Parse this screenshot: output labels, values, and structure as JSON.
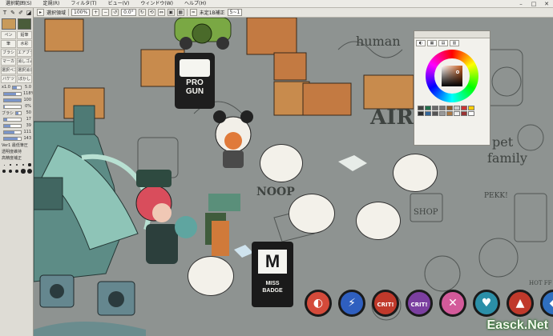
{
  "menubar": {
    "items": [
      "選択範囲(S)",
      "定規(R)",
      "フィルタ(T)",
      "ビュー(V)",
      "ウィンドウ(W)",
      "ヘルプ(H)"
    ],
    "window_buttons": [
      "–",
      "□",
      "✕"
    ]
  },
  "toolbar": {
    "selection_label": "選択領域",
    "zoom": "100%",
    "angle": "0.0°",
    "file_name": "未定1B補正",
    "file_field": "5~1"
  },
  "leftpanel": {
    "tools": [
      "T",
      "✎",
      "✐",
      "◪"
    ],
    "fg_color": "#c89a5a",
    "bg_color": "#4a5c3a",
    "brushes": [
      "ペン",
      "鉛筆",
      "筆",
      "水彩",
      "ブラシ",
      "エアブラ",
      "マーカ",
      "消しゴム",
      "選択ペン",
      "選択消し",
      "バケツ",
      "ぼかし"
    ],
    "sliders": [
      {
        "label": "x1.0",
        "value": "5.0",
        "fill": 0.5
      },
      {
        "label": "",
        "value": "118%",
        "fill": 0.7
      },
      {
        "label": "",
        "value": "100",
        "fill": 1.0
      },
      {
        "label": "",
        "value": "0%",
        "fill": 0.05
      },
      {
        "label": "ブラシ",
        "value": "50",
        "fill": 0.5
      },
      {
        "label": "",
        "value": "17",
        "fill": 0.2
      },
      {
        "label": "",
        "value": "39",
        "fill": 0.4
      },
      {
        "label": "",
        "value": "111",
        "fill": 0.6
      },
      {
        "label": "",
        "value": "143",
        "fill": 0.8
      }
    ],
    "options": [
      "Ver1 最低筆圧",
      "透明度維持",
      "高精度補正"
    ],
    "dot_sizes": [
      "1.5",
      "2",
      "3",
      "4",
      "5",
      "6",
      "7",
      "8",
      "9",
      "10"
    ]
  },
  "canvas": {
    "sketch_texts": [
      "human",
      "AIR",
      "pet",
      "family",
      "PEKK!",
      "SHOP",
      "NOOP",
      "HOT FF"
    ],
    "progun_text": "PRO GUN",
    "miss_badge_text": "MISS BADGE",
    "miss_badge_letter": "M",
    "crit_labels": [
      "CRIT!",
      "CRIT!"
    ]
  },
  "colorpanel": {
    "title": "",
    "tabs": [
      "◐",
      "▦",
      "▤",
      "▥"
    ],
    "swatches": [
      "#444444",
      "#1f6f4a",
      "#6a6a6a",
      "#777777",
      "#8b5a2b",
      "#cccccc",
      "#cc3333",
      "#ffcc00",
      "#2d2d2d",
      "#336699",
      "#555555",
      "#999999",
      "#aa7744",
      "#eeeeee",
      "#993333",
      "#ffffff"
    ]
  },
  "watermark": "Easck.Net"
}
